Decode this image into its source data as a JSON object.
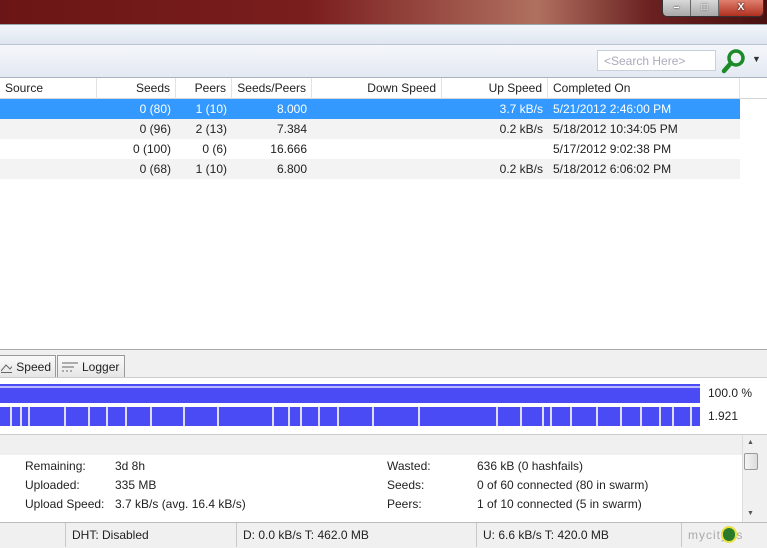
{
  "window": {
    "controls": {
      "minimize": "–",
      "maximize": "□",
      "close": "X"
    }
  },
  "search": {
    "placeholder": "<Search Here>"
  },
  "columns": [
    "Source",
    "Seeds",
    "Peers",
    "Seeds/Peers",
    "Down Speed",
    "Up Speed",
    "Completed On"
  ],
  "rows": [
    {
      "seeds": "0 (80)",
      "peers": "1 (10)",
      "ratio": "8.000",
      "down": "",
      "up": "3.7 kB/s",
      "completed": "5/21/2012 2:46:00 PM",
      "selected": true
    },
    {
      "seeds": "0 (96)",
      "peers": "2 (13)",
      "ratio": "7.384",
      "down": "",
      "up": "0.2 kB/s",
      "completed": "5/18/2012 10:34:05 PM"
    },
    {
      "seeds": "0 (100)",
      "peers": "0 (6)",
      "ratio": "16.666",
      "down": "",
      "up": "",
      "completed": "5/17/2012 9:02:38 PM"
    },
    {
      "seeds": "0 (68)",
      "peers": "1 (10)",
      "ratio": "6.800",
      "down": "",
      "up": "0.2 kB/s",
      "completed": "5/18/2012 6:06:02 PM"
    }
  ],
  "tabs": {
    "speed": "Speed",
    "logger": "Logger"
  },
  "progress": {
    "downloaded_label": "100.0 %",
    "downloaded_percent": 100,
    "availability_label": "1.921"
  },
  "info": {
    "remaining_label": "Remaining:",
    "remaining": "3d 8h",
    "uploaded_label": "Uploaded:",
    "uploaded": "335 MB",
    "upload_speed_label": "Upload Speed:",
    "upload_speed": "3.7 kB/s (avg. 16.4 kB/s)",
    "wasted_label": "Wasted:",
    "wasted": "636 kB (0 hashfails)",
    "seeds_label": "Seeds:",
    "seeds": "0 of 60 connected (80 in swarm)",
    "peers_label": "Peers:",
    "peers": "1 of 10 connected (5 in swarm)"
  },
  "status": {
    "dht": "DHT: Disabled",
    "down": "D: 0.0 kB/s T: 462.0 MB",
    "up": "U: 6.6 kB/s T: 420.0 MB",
    "watermark": "mycity.rs"
  }
}
